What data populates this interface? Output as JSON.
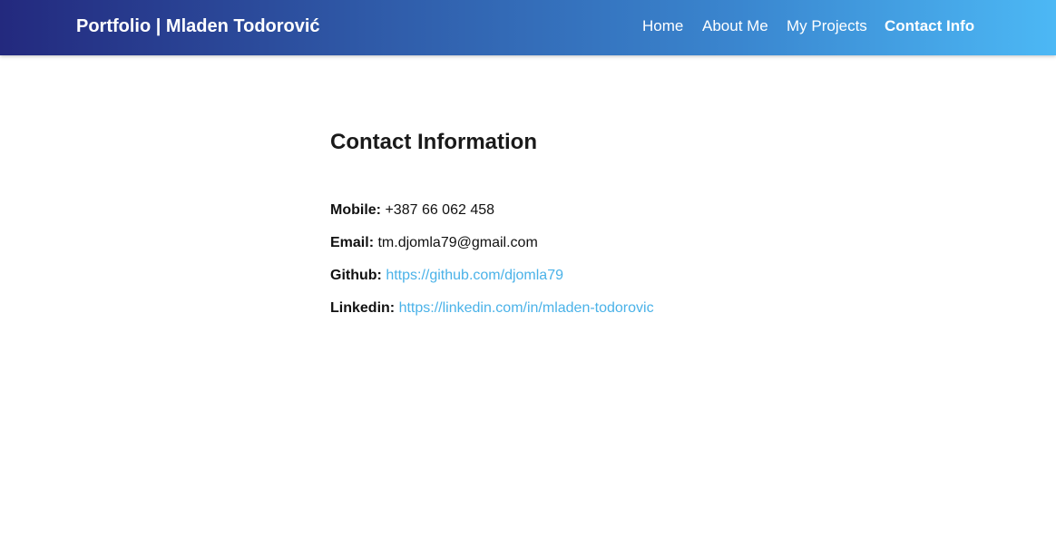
{
  "header": {
    "brand": "Portfolio | Mladen Todorović",
    "nav": {
      "home": "Home",
      "about": "About Me",
      "projects": "My Projects",
      "contact": "Contact Info"
    },
    "active_tab": "contact"
  },
  "main": {
    "title": "Contact Information",
    "mobile": {
      "label": "Mobile:",
      "value": "+387 66 062 458"
    },
    "email": {
      "label": "Email:",
      "value": "tm.djomla79@gmail.com"
    },
    "github": {
      "label": "Github:",
      "value": "https://github.com/djomla79"
    },
    "linkedin": {
      "label": "Linkedin:",
      "value": "https://linkedin.com/in/mladen-todorovic"
    }
  },
  "colors": {
    "nav_gradient_start": "#23297e",
    "nav_gradient_end": "#4cb8f5",
    "link": "#4ab2e8",
    "text": "#111111"
  }
}
